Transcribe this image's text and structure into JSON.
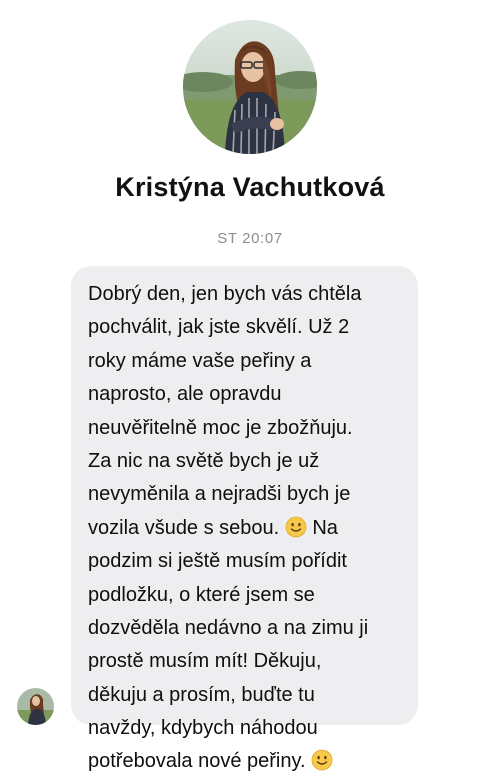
{
  "contact": {
    "name": "Kristýna Vachutková",
    "avatar_icon": "profile-photo-woman-field"
  },
  "conversation": {
    "timestamp": "ST 20:07"
  },
  "message": {
    "lines": [
      "Dobrý den, jen bych vás chtěla",
      "pochválit, jak jste skvělí. Už 2",
      "roky máme vaše peřiny a",
      "naprosto, ale opravdu",
      "neuvěřitelně moc je zbožňuju.",
      "Za nic na světě bych je už",
      "nevyměnila a nejradši bych je",
      "vozila všude s sebou.",
      "Na",
      "podzim si ještě musím pořídit",
      "podložku, o které jsem se",
      "dozvěděla nedávno a na zimu ji",
      "prostě musím mít! Děkuju,",
      "děkuju a prosím, buďte tu",
      "navždy, kdybych náhodou",
      "potřebovala nové peřiny."
    ],
    "emoji_icon": "slightly-smiling-face-icon"
  },
  "colors": {
    "bubble_background": "#eeeef0",
    "timestamp_text": "#8e8e93",
    "name_text": "#111111"
  }
}
